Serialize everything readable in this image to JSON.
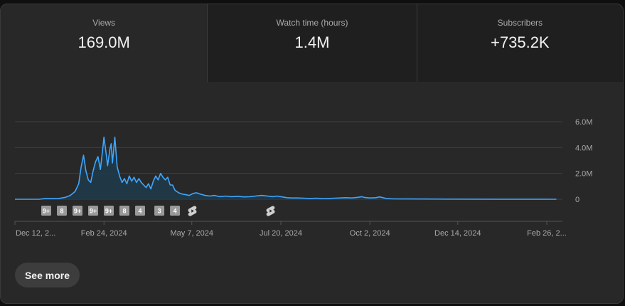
{
  "metrics": [
    {
      "label": "Views",
      "value": "169.0M"
    },
    {
      "label": "Watch time (hours)",
      "value": "1.4M"
    },
    {
      "label": "Subscribers",
      "value": "+735.2K"
    }
  ],
  "see_more_label": "See more",
  "colors": {
    "line": "#3ea6ff",
    "fill": "#1e3a4a",
    "grid": "#3f3f3f",
    "text": "#aaaaaa"
  },
  "chart_data": {
    "type": "area",
    "title": "",
    "xlabel": "",
    "ylabel": "",
    "ylim": [
      0,
      6000000
    ],
    "y_ticks": [
      {
        "value": 0,
        "label": "0"
      },
      {
        "value": 2000000,
        "label": "2.0M"
      },
      {
        "value": 4000000,
        "label": "4.0M"
      },
      {
        "value": 6000000,
        "label": "6.0M"
      }
    ],
    "x_ticks": [
      {
        "day": 0,
        "label": "Dec 12, 2..."
      },
      {
        "day": 74,
        "label": "Feb 24, 2024"
      },
      {
        "day": 147,
        "label": "May 7, 2024"
      },
      {
        "day": 221,
        "label": "Jul 20, 2024"
      },
      {
        "day": 295,
        "label": "Oct 2, 2024"
      },
      {
        "day": 368,
        "label": "Dec 14, 2024"
      },
      {
        "day": 442,
        "label": "Feb 26, 2..."
      }
    ],
    "x_range": [
      0,
      455
    ],
    "series": [
      {
        "points": [
          [
            0,
            0
          ],
          [
            20,
            0
          ],
          [
            25,
            50000
          ],
          [
            30,
            50000
          ],
          [
            36,
            50000
          ],
          [
            42,
            150000
          ],
          [
            46,
            300000
          ],
          [
            50,
            600000
          ],
          [
            53,
            1200000
          ],
          [
            55,
            2500000
          ],
          [
            57,
            3400000
          ],
          [
            59,
            2200000
          ],
          [
            61,
            1500000
          ],
          [
            63,
            1300000
          ],
          [
            65,
            2200000
          ],
          [
            67,
            2900000
          ],
          [
            69,
            3300000
          ],
          [
            71,
            2300000
          ],
          [
            73,
            3900000
          ],
          [
            74,
            4800000
          ],
          [
            76,
            3400000
          ],
          [
            77,
            2600000
          ],
          [
            79,
            3900000
          ],
          [
            80,
            4300000
          ],
          [
            81,
            2800000
          ],
          [
            83,
            4800000
          ],
          [
            85,
            2500000
          ],
          [
            87,
            1800000
          ],
          [
            89,
            1300000
          ],
          [
            91,
            1600000
          ],
          [
            93,
            1200000
          ],
          [
            95,
            1800000
          ],
          [
            97,
            1400000
          ],
          [
            99,
            1700000
          ],
          [
            101,
            1300000
          ],
          [
            103,
            1600000
          ],
          [
            105,
            1300000
          ],
          [
            107,
            1100000
          ],
          [
            109,
            900000
          ],
          [
            111,
            1200000
          ],
          [
            113,
            800000
          ],
          [
            115,
            1400000
          ],
          [
            117,
            1800000
          ],
          [
            119,
            1500000
          ],
          [
            121,
            2000000
          ],
          [
            123,
            1700000
          ],
          [
            125,
            1500000
          ],
          [
            127,
            1700000
          ],
          [
            129,
            1100000
          ],
          [
            131,
            1100000
          ],
          [
            133,
            700000
          ],
          [
            136,
            500000
          ],
          [
            139,
            400000
          ],
          [
            142,
            350000
          ],
          [
            145,
            300000
          ],
          [
            148,
            450000
          ],
          [
            151,
            500000
          ],
          [
            154,
            400000
          ],
          [
            158,
            300000
          ],
          [
            162,
            250000
          ],
          [
            166,
            300000
          ],
          [
            170,
            200000
          ],
          [
            175,
            250000
          ],
          [
            180,
            200000
          ],
          [
            185,
            230000
          ],
          [
            190,
            180000
          ],
          [
            195,
            200000
          ],
          [
            200,
            250000
          ],
          [
            205,
            300000
          ],
          [
            210,
            250000
          ],
          [
            214,
            200000
          ],
          [
            218,
            250000
          ],
          [
            222,
            180000
          ],
          [
            226,
            120000
          ],
          [
            230,
            100000
          ],
          [
            235,
            100000
          ],
          [
            240,
            80000
          ],
          [
            245,
            60000
          ],
          [
            250,
            80000
          ],
          [
            255,
            60000
          ],
          [
            260,
            50000
          ],
          [
            265,
            80000
          ],
          [
            270,
            100000
          ],
          [
            275,
            120000
          ],
          [
            280,
            100000
          ],
          [
            285,
            150000
          ],
          [
            288,
            200000
          ],
          [
            291,
            130000
          ],
          [
            295,
            100000
          ],
          [
            300,
            120000
          ],
          [
            303,
            180000
          ],
          [
            306,
            120000
          ],
          [
            309,
            50000
          ],
          [
            315,
            30000
          ],
          [
            330,
            20000
          ],
          [
            360,
            10000
          ],
          [
            400,
            5000
          ],
          [
            450,
            0
          ]
        ]
      }
    ],
    "annotations": [
      {
        "day": 26,
        "label": "9+"
      },
      {
        "day": 39,
        "label": "8"
      },
      {
        "day": 52,
        "label": "9+"
      },
      {
        "day": 65,
        "label": "9+"
      },
      {
        "day": 78,
        "label": "9+"
      },
      {
        "day": 91,
        "label": "8"
      },
      {
        "day": 104,
        "label": "4"
      },
      {
        "day": 120,
        "label": "3"
      },
      {
        "day": 133,
        "label": "4"
      }
    ],
    "shorts_markers": [
      {
        "day": 147
      },
      {
        "day": 212
      }
    ]
  }
}
